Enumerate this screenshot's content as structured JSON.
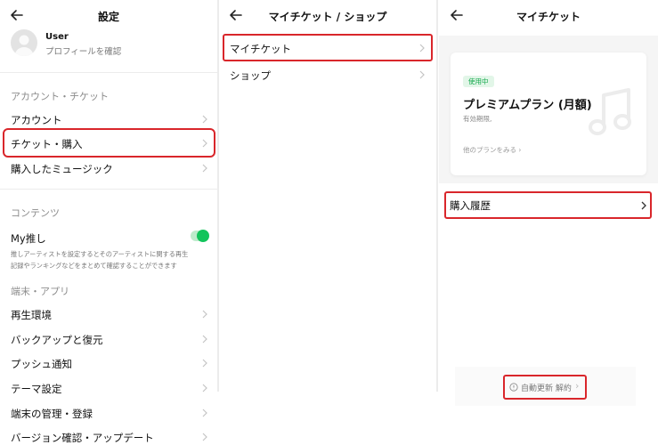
{
  "settings": {
    "title": "設定",
    "user": {
      "name": "User",
      "subtitle": "プロフィールを確認"
    },
    "section_account": "アカウント・チケット",
    "items_account": [
      {
        "label": "アカウント"
      },
      {
        "label": "チケット・購入"
      },
      {
        "label": "購入したミュージック"
      }
    ],
    "section_content": "コンテンツ",
    "my_oshi": {
      "label": "My推し",
      "description_line1": "推しアーティストを設定するとそのアーティストに関する再生",
      "description_line2": "記録やランキングなどをまとめて確認することができます",
      "enabled": true
    },
    "section_device": "端末・アプリ",
    "items_device": [
      {
        "label": "再生環境"
      },
      {
        "label": "バックアップと復元"
      },
      {
        "label": "プッシュ通知"
      },
      {
        "label": "テーマ設定"
      },
      {
        "label": "端末の管理・登録"
      },
      {
        "label": "バージョン確認・アップデート"
      }
    ]
  },
  "ticket_shop": {
    "title": "マイチケット / ショップ",
    "items": [
      {
        "label": "マイチケット"
      },
      {
        "label": "ショップ"
      }
    ]
  },
  "my_ticket": {
    "title": "マイチケット",
    "card": {
      "badge": "使用中",
      "plan_name": "プレミアムプラン (月額)",
      "validity": "有効期限,",
      "other_plans": "他のプランをみる"
    },
    "purchase_history": "購入履歴",
    "auto_renew": "自動更新 解約"
  },
  "colors": {
    "accent_green": "#12c45b",
    "highlight_red": "#d9262b",
    "muted_bg": "#f5f5f5"
  }
}
